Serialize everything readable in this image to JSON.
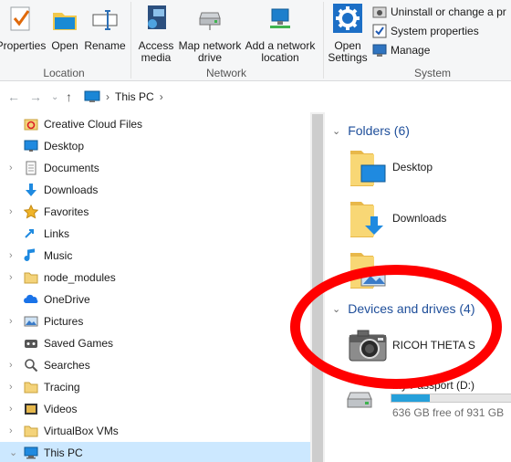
{
  "ribbon": {
    "properties_label": "Properties",
    "open_label": "Open",
    "rename_label": "Rename",
    "access_media_label": "Access media",
    "map_network_drive_label": "Map network drive",
    "add_network_location_label": "Add a network location",
    "open_settings_label": "Open Settings",
    "uninstall_label": "Uninstall or change a pr",
    "system_properties_label": "System properties",
    "manage_label": "Manage",
    "group_location": "Location",
    "group_network": "Network",
    "group_system": "System"
  },
  "address": {
    "path_root": "This PC"
  },
  "nav": {
    "items": [
      {
        "label": "Creative Cloud Files",
        "icon": "creative-cloud-icon",
        "expandable": false
      },
      {
        "label": "Desktop",
        "icon": "desktop-icon",
        "expandable": false
      },
      {
        "label": "Documents",
        "icon": "documents-icon",
        "expandable": true
      },
      {
        "label": "Downloads",
        "icon": "downloads-icon",
        "expandable": false
      },
      {
        "label": "Favorites",
        "icon": "favorites-icon",
        "expandable": true
      },
      {
        "label": "Links",
        "icon": "links-icon",
        "expandable": false
      },
      {
        "label": "Music",
        "icon": "music-icon",
        "expandable": true
      },
      {
        "label": "node_modules",
        "icon": "folder-icon",
        "expandable": true
      },
      {
        "label": "OneDrive",
        "icon": "onedrive-icon",
        "expandable": false
      },
      {
        "label": "Pictures",
        "icon": "pictures-icon",
        "expandable": true
      },
      {
        "label": "Saved Games",
        "icon": "saved-games-icon",
        "expandable": false
      },
      {
        "label": "Searches",
        "icon": "searches-icon",
        "expandable": true
      },
      {
        "label": "Tracing",
        "icon": "folder-icon",
        "expandable": true
      },
      {
        "label": "Videos",
        "icon": "videos-icon",
        "expandable": true
      },
      {
        "label": "VirtualBox VMs",
        "icon": "folder-icon",
        "expandable": true
      },
      {
        "label": "This PC",
        "icon": "this-pc-icon",
        "expandable": true,
        "selected": true
      }
    ]
  },
  "content": {
    "folders_header": "Folders (6)",
    "folders": [
      {
        "label": "Desktop",
        "icon": "desktop-folder-icon"
      },
      {
        "label": "Downloads",
        "icon": "downloads-folder-icon"
      },
      {
        "label": "",
        "icon": "pictures-folder-icon"
      }
    ],
    "devices_header": "Devices and drives (4)",
    "devices": [
      {
        "label": "RICOH THETA S",
        "icon": "camera-icon"
      },
      {
        "label": "My Passport (D:)",
        "icon": "drive-icon",
        "free_text": "636 GB free of 931 GB",
        "used_fraction": 0.317
      }
    ]
  },
  "colors": {
    "selection": "#cce8ff",
    "section_header": "#1e4e9a",
    "annotation": "#ff0000",
    "drive_bar": "#26a0da"
  }
}
